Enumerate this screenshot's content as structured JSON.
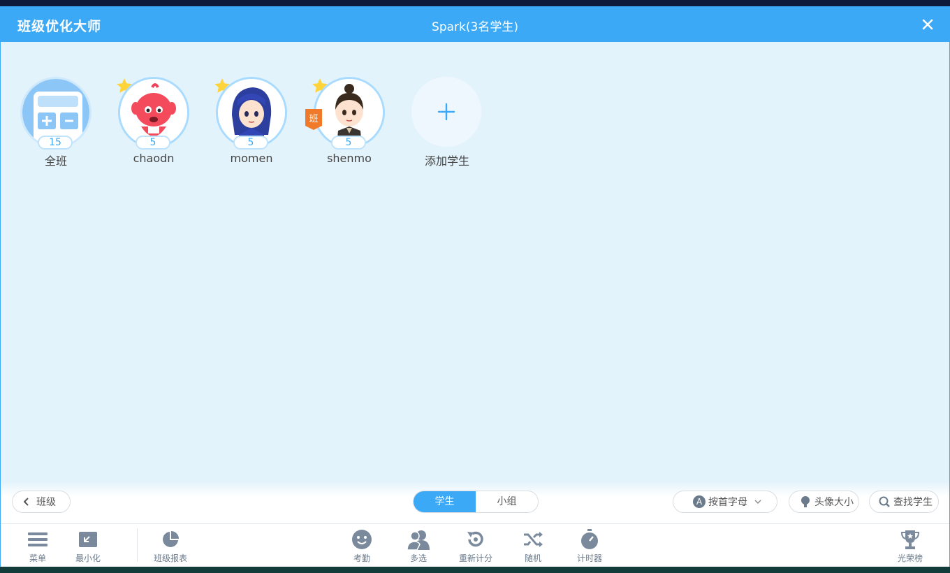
{
  "colors": {
    "accent": "#3ba9f5",
    "background": "#e3f3fb",
    "icon": "#7a8a9c"
  },
  "titlebar": {
    "app_name": "班级优化大师",
    "class_title": "Spark(3名学生)",
    "close_icon": "close-icon"
  },
  "students": [
    {
      "name": "全班",
      "score": "15",
      "icon": "calculator-icon"
    },
    {
      "name": "chaodn",
      "score": "5",
      "icon": "pink-monster-avatar"
    },
    {
      "name": "momen",
      "score": "5",
      "icon": "blue-hair-avatar"
    },
    {
      "name": "shenmo",
      "score": "5",
      "icon": "topknot-boy-avatar",
      "badge": "班"
    }
  ],
  "add_student": {
    "label": "添加学生",
    "icon": "plus-icon"
  },
  "bottom_bar": {
    "back_label": "班级",
    "tabs": [
      "学生",
      "小组"
    ],
    "sort_label": "按首字母",
    "sort_badge": "A",
    "avatar_size_label": "头像大小",
    "search_label": "查找学生"
  },
  "toolbar": {
    "menu": "菜单",
    "minimize": "最小化",
    "report": "班级报表",
    "attendance": "考勤",
    "multi_select": "多选",
    "reset_score": "重新计分",
    "random": "随机",
    "timer": "计时器",
    "honor": "光荣榜"
  }
}
